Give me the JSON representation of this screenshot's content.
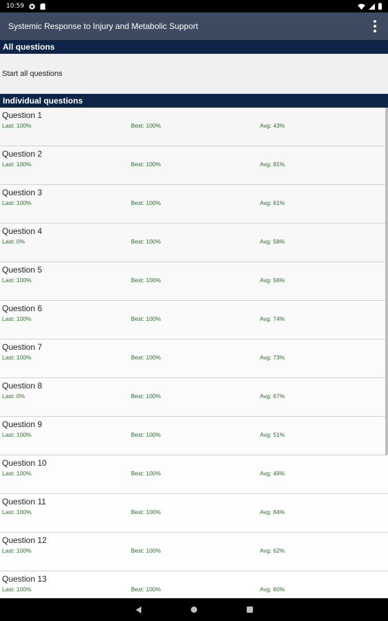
{
  "status": {
    "time": "10:59"
  },
  "appbar": {
    "title": "Systemic Response to Injury and Metabolic Support"
  },
  "all_questions": {
    "header": "All questions",
    "start_label": "Start all questions"
  },
  "individual": {
    "header": "Individual questions",
    "questions": [
      {
        "name": "Question 1",
        "last": "Last: 100%",
        "best": "Best: 100%",
        "avg": "Avg: 43%"
      },
      {
        "name": "Question 2",
        "last": "Last: 100%",
        "best": "Best: 100%",
        "avg": "Avg: 81%"
      },
      {
        "name": "Question 3",
        "last": "Last: 100%",
        "best": "Best: 100%",
        "avg": "Avg: 61%"
      },
      {
        "name": "Question 4",
        "last": "Last: 0%",
        "best": "Best: 100%",
        "avg": "Avg: 58%"
      },
      {
        "name": "Question 5",
        "last": "Last: 100%",
        "best": "Best: 100%",
        "avg": "Avg: 56%"
      },
      {
        "name": "Question 6",
        "last": "Last: 100%",
        "best": "Best: 100%",
        "avg": "Avg: 74%"
      },
      {
        "name": "Question 7",
        "last": "Last: 100%",
        "best": "Best: 100%",
        "avg": "Avg: 73%"
      },
      {
        "name": "Question 8",
        "last": "Last: 0%",
        "best": "Best: 100%",
        "avg": "Avg: 67%"
      },
      {
        "name": "Question 9",
        "last": "Last: 100%",
        "best": "Best: 100%",
        "avg": "Avg: 51%"
      },
      {
        "name": "Question 10",
        "last": "Last: 100%",
        "best": "Best: 100%",
        "avg": "Avg: 49%"
      },
      {
        "name": "Question 11",
        "last": "Last: 100%",
        "best": "Best: 100%",
        "avg": "Avg: 84%"
      },
      {
        "name": "Question 12",
        "last": "Last: 100%",
        "best": "Best: 100%",
        "avg": "Avg: 62%"
      },
      {
        "name": "Question 13",
        "last": "Last: 100%",
        "best": "Best: 100%",
        "avg": "Avg: 60%"
      }
    ]
  },
  "icons": {
    "status": [
      "settings-icon",
      "sd-card-icon",
      "wifi-icon",
      "signal-icon",
      "battery-icon"
    ],
    "appbar": "more-vert-icon",
    "nav": [
      "back-icon",
      "home-icon",
      "recents-icon"
    ]
  },
  "colors": {
    "appbar": "#3d4a5f",
    "section_header": "#0f2548",
    "stat_text": "#2e6a2e"
  }
}
